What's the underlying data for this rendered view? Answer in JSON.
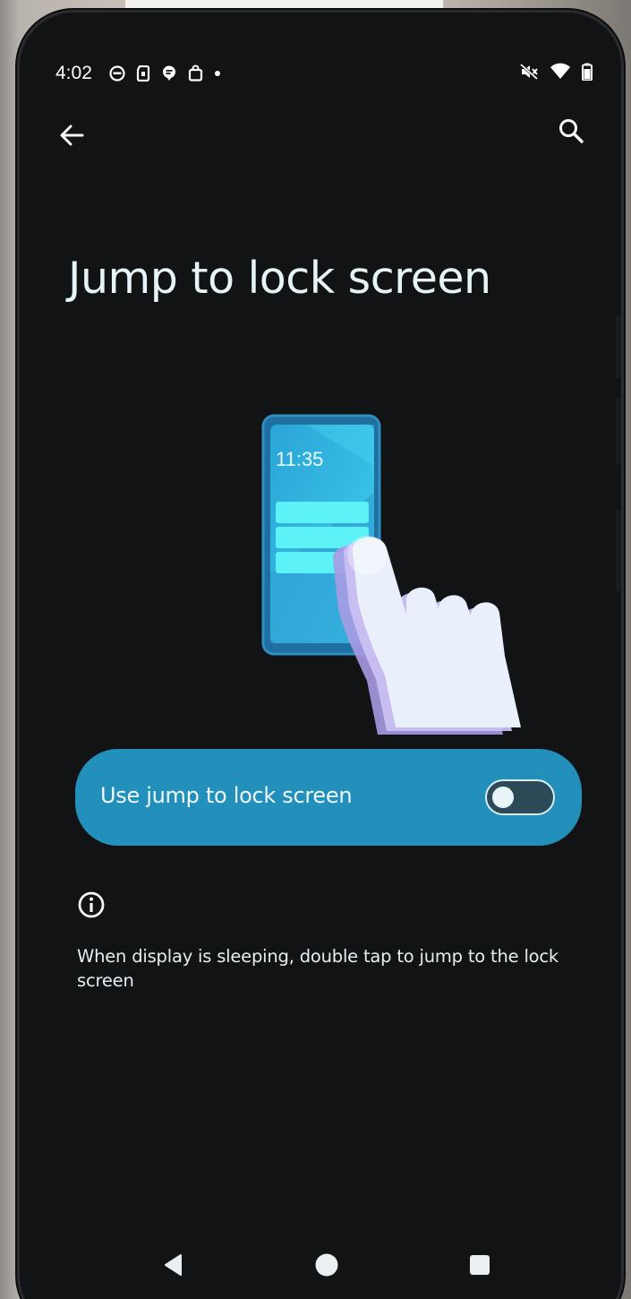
{
  "status_bar": {
    "time": "4:02",
    "notification_icons": [
      "notification-icon",
      "sim-icon",
      "message-icon",
      "shopping-bag-icon",
      "dot-icon"
    ],
    "right_icons": [
      "mute-icon",
      "wifi-icon",
      "battery-icon"
    ]
  },
  "app_bar": {
    "back_icon": "arrow-left-icon",
    "search_icon": "search-icon"
  },
  "page": {
    "title": "Jump to lock screen"
  },
  "illustration": {
    "clock_text": "11:35"
  },
  "toggle": {
    "label": "Use jump to lock screen",
    "checked": false
  },
  "info": {
    "icon": "info-icon",
    "text": "When display is sleeping, double tap to jump to the lock screen"
  },
  "nav_bar": {
    "icons": [
      "back-triangle-icon",
      "home-circle-icon",
      "recents-square-icon"
    ]
  },
  "colors": {
    "background": "#121314",
    "accent": "#2290ba",
    "illustration_screen": "#3bbfe6",
    "title_text": "#e6f4f7"
  }
}
